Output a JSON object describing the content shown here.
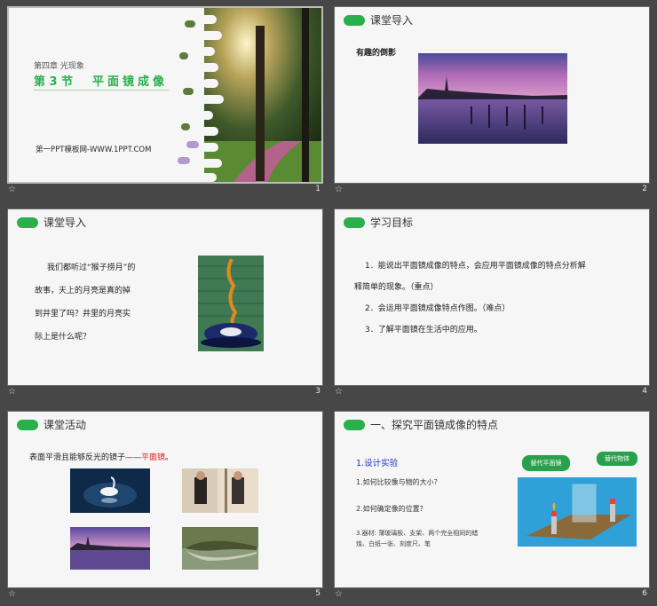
{
  "slides": [
    {
      "number": "1",
      "chapter": "第四章 光现象",
      "section": "第 3 节",
      "title": "平面镜成像",
      "site": "第一PPT模板网-WWW.1PPT.COM"
    },
    {
      "number": "2",
      "title": "课堂导入",
      "caption": "有趣的倒影"
    },
    {
      "number": "3",
      "title": "课堂导入",
      "lines": [
        "我们都听过“猴子捞月”的",
        "故事，天上的月亮是真的掉",
        "到井里了吗？井里的月亮实",
        "际上是什么呢？"
      ]
    },
    {
      "number": "4",
      "title": "学习目标",
      "lines": [
        "1．能说出平面镜成像的特点，会应用平面镜成像的特点分析解",
        "释简单的现象。（重点）",
        "2．会运用平面镜成像特点作图。（难点）",
        "3．了解平面镜在生活中的应用。"
      ]
    },
    {
      "number": "5",
      "title": "课堂活动",
      "desc_prefix": "表面平滑且能够反光的镜子——",
      "desc_highlight": "平面镜",
      "desc_suffix": "。"
    },
    {
      "number": "6",
      "title": "一、探究平面镜成像的特点",
      "subhead": "1.设计实验",
      "q1": "1.如何比较像与物的大小？",
      "q2": "2.如何确定像的位置？",
      "equip1": "3.器材: 薄玻璃板、支架、两个完全相同的蜡",
      "equip2": "烛、白纸一张、刻度尺、笔",
      "bubble1": "替代平面镜",
      "bubble2": "替代物体"
    }
  ],
  "footer_icon": "star-icon",
  "colors": {
    "accent_green": "#29b04a",
    "link_blue": "#1a33c8",
    "highlight_red": "#e02020",
    "background": "#474747"
  }
}
